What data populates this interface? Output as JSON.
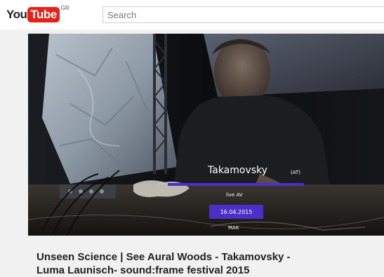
{
  "masthead": {
    "logo_you": "You",
    "logo_tube": "Tube",
    "logo_country": "GR",
    "search_placeholder": "Search"
  },
  "player": {
    "artist": "Takamovsky",
    "origin": "(AT)",
    "type": "live AV",
    "date": "16.04.2015",
    "venue": "MAK",
    "accent_color": "#4b2fc9"
  },
  "video": {
    "title": "Unseen Science | See Aural Woods - Takamovsky - Luma Launisch- sound:frame festival 2015"
  }
}
